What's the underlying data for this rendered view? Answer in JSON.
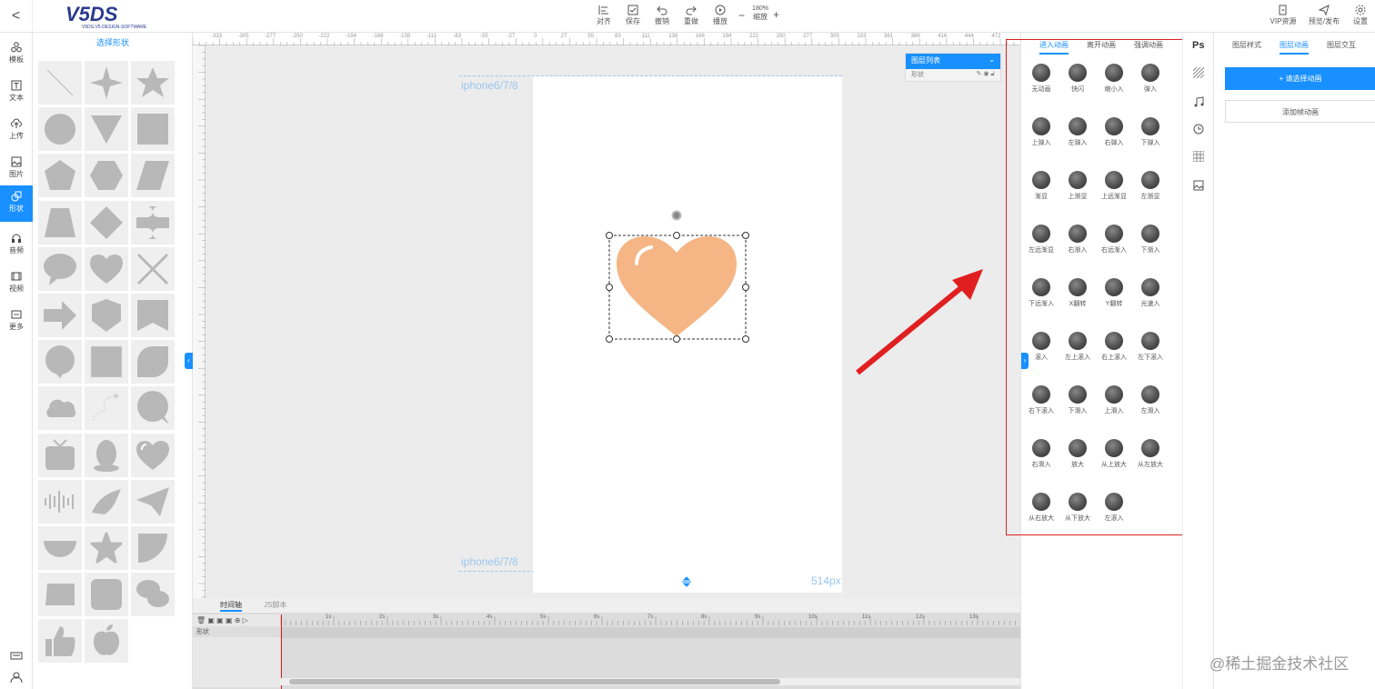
{
  "topbar": {
    "back": "<",
    "logo": "V5DS",
    "logo_sub": "V5DS.V5-DESIGN-SOFTWARE",
    "tools": [
      {
        "label": "对齐",
        "icon": "align-icon"
      },
      {
        "label": "保存",
        "icon": "save-icon"
      },
      {
        "label": "撤销",
        "icon": "undo-icon"
      },
      {
        "label": "重做",
        "icon": "redo-icon"
      },
      {
        "label": "播放",
        "icon": "play-icon"
      }
    ],
    "zoom_value": "180%",
    "zoom_label": "缩放",
    "zoom_minus": "−",
    "zoom_plus": "+",
    "right_tools": [
      {
        "label": "VIP资源",
        "icon": "vip-icon"
      },
      {
        "label": "预览/发布",
        "icon": "send-icon"
      },
      {
        "label": "设置",
        "icon": "gear-icon"
      }
    ]
  },
  "leftnav": [
    {
      "label": "模板",
      "icon": "template-icon"
    },
    {
      "label": "文本",
      "icon": "text-icon"
    },
    {
      "label": "上传",
      "icon": "upload-icon"
    },
    {
      "label": "图片",
      "icon": "image-icon"
    },
    {
      "label": "形状",
      "icon": "shape-icon",
      "active": true
    },
    {
      "label": "音频",
      "icon": "headphones-icon"
    },
    {
      "label": "视频",
      "icon": "film-icon"
    },
    {
      "label": "更多",
      "icon": "more-icon"
    }
  ],
  "shapes": {
    "title": "选择形状",
    "items": [
      "line",
      "star4",
      "star5",
      "circle",
      "triangle-down",
      "square",
      "pentagon",
      "hexagon",
      "parallelogram",
      "trapezoid",
      "diamond",
      "cross-plus",
      "speech-bubble",
      "heart",
      "x-cross",
      "arrow-right",
      "shield",
      "banner",
      "circle-bubble",
      "stamp",
      "leaf",
      "cloud",
      "curve-arrow",
      "round-bubble",
      "tv",
      "penguin",
      "heart-outline",
      "sound-wave",
      "bird",
      "paper-plane",
      "half-circle",
      "star-round",
      "quarter-circle",
      "rounded-rect",
      "rounded-square",
      "wechat",
      "thumbs-up",
      "apple"
    ]
  },
  "ruler": {
    "labels": [
      "-333",
      "-305",
      "-277",
      "-250",
      "-222",
      "-194",
      "-166",
      "-138",
      "-111",
      "-83",
      "-55",
      "-27",
      "0",
      "27",
      "55",
      "83",
      "111",
      "138",
      "166",
      "194",
      "222",
      "250",
      "277",
      "305",
      "333",
      "361",
      "388",
      "416",
      "444",
      "472"
    ]
  },
  "canvas": {
    "device_top": "iphone6/7/8",
    "device_bottom": "iphone6/7/8",
    "height_label": "514px",
    "shape_color": "#f5b584"
  },
  "layerlist": {
    "title": "图层列表",
    "row": "形状"
  },
  "timeline": {
    "tabs": [
      "时间轴",
      "JS脚本"
    ],
    "layer": "形状",
    "ticks": [
      "1s",
      "2s",
      "3s",
      "4s",
      "5s",
      "6s",
      "7s",
      "8s",
      "9s",
      "10s",
      "11s",
      "12s",
      "13s"
    ]
  },
  "anim": {
    "tabs": [
      "进入动画",
      "离开动画",
      "强调动画"
    ],
    "items": [
      "无动画",
      "快闪",
      "缩小入",
      "弹入",
      "上弹入",
      "左弹入",
      "右弹入",
      "下弹入",
      "渐显",
      "上渐显",
      "上远渐显",
      "左渐显",
      "左远渐显",
      "右渐入",
      "右远渐入",
      "下渐入",
      "下远渐入",
      "X翻转",
      "Y翻转",
      "光速入",
      "滚入",
      "左上滚入",
      "右上滚入",
      "左下滚入",
      "右下滚入",
      "下滑入",
      "上滑入",
      "左滑入",
      "右滑入",
      "放大",
      "从上放大",
      "从左放大",
      "从右放大",
      "从下放大",
      "左滚入"
    ]
  },
  "iconstrip": [
    "Ps",
    "pattern-icon",
    "music-icon",
    "clock-icon",
    "grid-icon",
    "picture-icon"
  ],
  "right": {
    "tabs": [
      "图层样式",
      "图层动画",
      "图层交互"
    ],
    "btn_primary": "+ 请选择动画",
    "btn_secondary": "添加帧动画"
  },
  "watermark": "@稀土掘金技术社区",
  "colors": {
    "accent": "#1890ff",
    "annotation": "#e02020"
  }
}
